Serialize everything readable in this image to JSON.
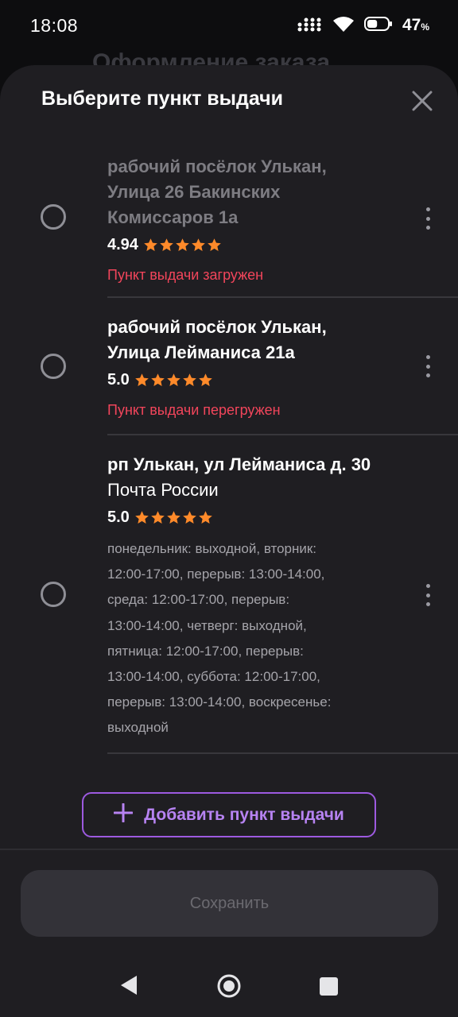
{
  "status_bar": {
    "time": "18:08",
    "battery_percent": "47",
    "battery_unit": "%",
    "battery_level": 0.47
  },
  "background_screen": {
    "title": "Оформление заказа"
  },
  "sheet": {
    "title": "Выберите пункт выдачи",
    "points": [
      {
        "address_lines": [
          "рабочий посёлок Улькан,",
          "Улица 26 Бакинских",
          "Комиссаров 1а"
        ],
        "rating": "4.94",
        "stars": 5,
        "status": "Пункт выдачи загружен",
        "dimmed": true
      },
      {
        "address_lines": [
          "рабочий посёлок Улькан,",
          "Улица Лейманиса 21а"
        ],
        "rating": "5.0",
        "stars": 5,
        "status": "Пункт выдачи перегружен",
        "dimmed": false
      },
      {
        "address_lines": [
          "рп Улькан, ул Лейманиса д. 30"
        ],
        "subtitle": "Почта России",
        "rating": "5.0",
        "stars": 5,
        "hours_lines": [
          "понедельник: выходной, вторник:",
          "12:00-17:00, перерыв: 13:00-14:00,",
          "среда: 12:00-17:00, перерыв:",
          "13:00-14:00, четверг: выходной,",
          "пятница: 12:00-17:00, перерыв:",
          "13:00-14:00, суббота: 12:00-17:00,",
          "перерыв: 13:00-14:00, воскресенье:",
          "выходной"
        ]
      }
    ],
    "add_button_label": "Добавить пункт выдачи",
    "save_button_label": "Сохранить"
  },
  "colors": {
    "sheet_bg": "#1f1e22",
    "accent_purple": "#b783f2",
    "warning_red": "#f2455b",
    "star_orange": "#ff8a2a"
  },
  "icons": {
    "close": "close-icon",
    "more": "more-vertical-icon",
    "add": "plus-icon",
    "star": "star-icon",
    "signal": "signal-icon",
    "wifi": "wifi-icon",
    "battery": "battery-icon",
    "nav_back": "back-triangle-icon",
    "nav_home": "home-circle-icon",
    "nav_recents": "recents-square-icon"
  }
}
